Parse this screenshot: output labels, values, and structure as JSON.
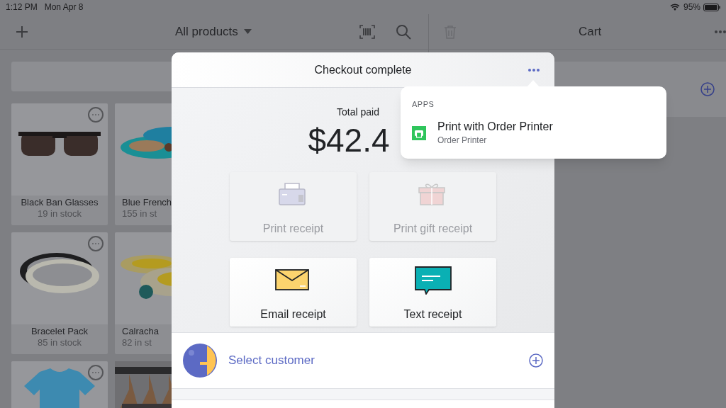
{
  "status_bar": {
    "time": "1:12 PM",
    "date": "Mon Apr 8",
    "battery": "95%"
  },
  "products_header": {
    "title": "All products"
  },
  "products": [
    {
      "name": "Black Ban Glasses",
      "stock": "19 in stock",
      "menu": "⋯"
    },
    {
      "name": "Blue French",
      "stock": "155 in st"
    },
    {
      "name": "Bracelet Pack",
      "stock": "85 in stock",
      "menu": "⋯"
    },
    {
      "name": "Calracha",
      "stock": "82 in st"
    },
    {
      "menu": "⋯"
    },
    {
      "kind": "picture"
    }
  ],
  "cart": {
    "title": "Cart"
  },
  "modal": {
    "title": "Checkout complete",
    "total_label": "Total paid",
    "total": "$42.4",
    "actions": [
      {
        "label": "Print receipt",
        "kind": "printer",
        "disabled": true
      },
      {
        "label": "Print gift receipt",
        "kind": "gift",
        "disabled": true
      },
      {
        "label": "Email receipt",
        "kind": "email",
        "disabled": false
      },
      {
        "label": "Text receipt",
        "kind": "message",
        "disabled": false
      }
    ],
    "customer": {
      "label": "Select customer"
    }
  },
  "popover": {
    "section": "APPS",
    "items": [
      {
        "title": "Print with Order Printer",
        "subtitle": "Order Printer"
      }
    ]
  }
}
